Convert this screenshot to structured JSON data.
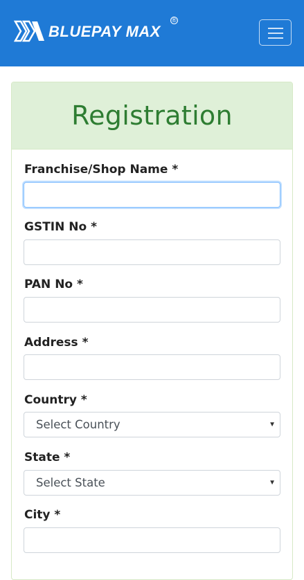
{
  "header": {
    "brand_name": "BLUEPAY MAX",
    "brand_mark": "®",
    "background_color": "#1f7ad6",
    "menu_icon": "hamburger-menu-icon"
  },
  "form": {
    "title": "Registration",
    "header_color": "#dff0d8",
    "title_color": "#2e7d32",
    "fields": {
      "shop_name": {
        "label": "Franchise/Shop Name *",
        "value": ""
      },
      "gstin": {
        "label": "GSTIN No *",
        "value": ""
      },
      "pan": {
        "label": "PAN No *",
        "value": ""
      },
      "address": {
        "label": "Address *",
        "value": ""
      },
      "country": {
        "label": "Country *",
        "selected": "Select Country"
      },
      "state": {
        "label": "State *",
        "selected": "Select State"
      },
      "city": {
        "label": "City *",
        "value": ""
      }
    }
  }
}
